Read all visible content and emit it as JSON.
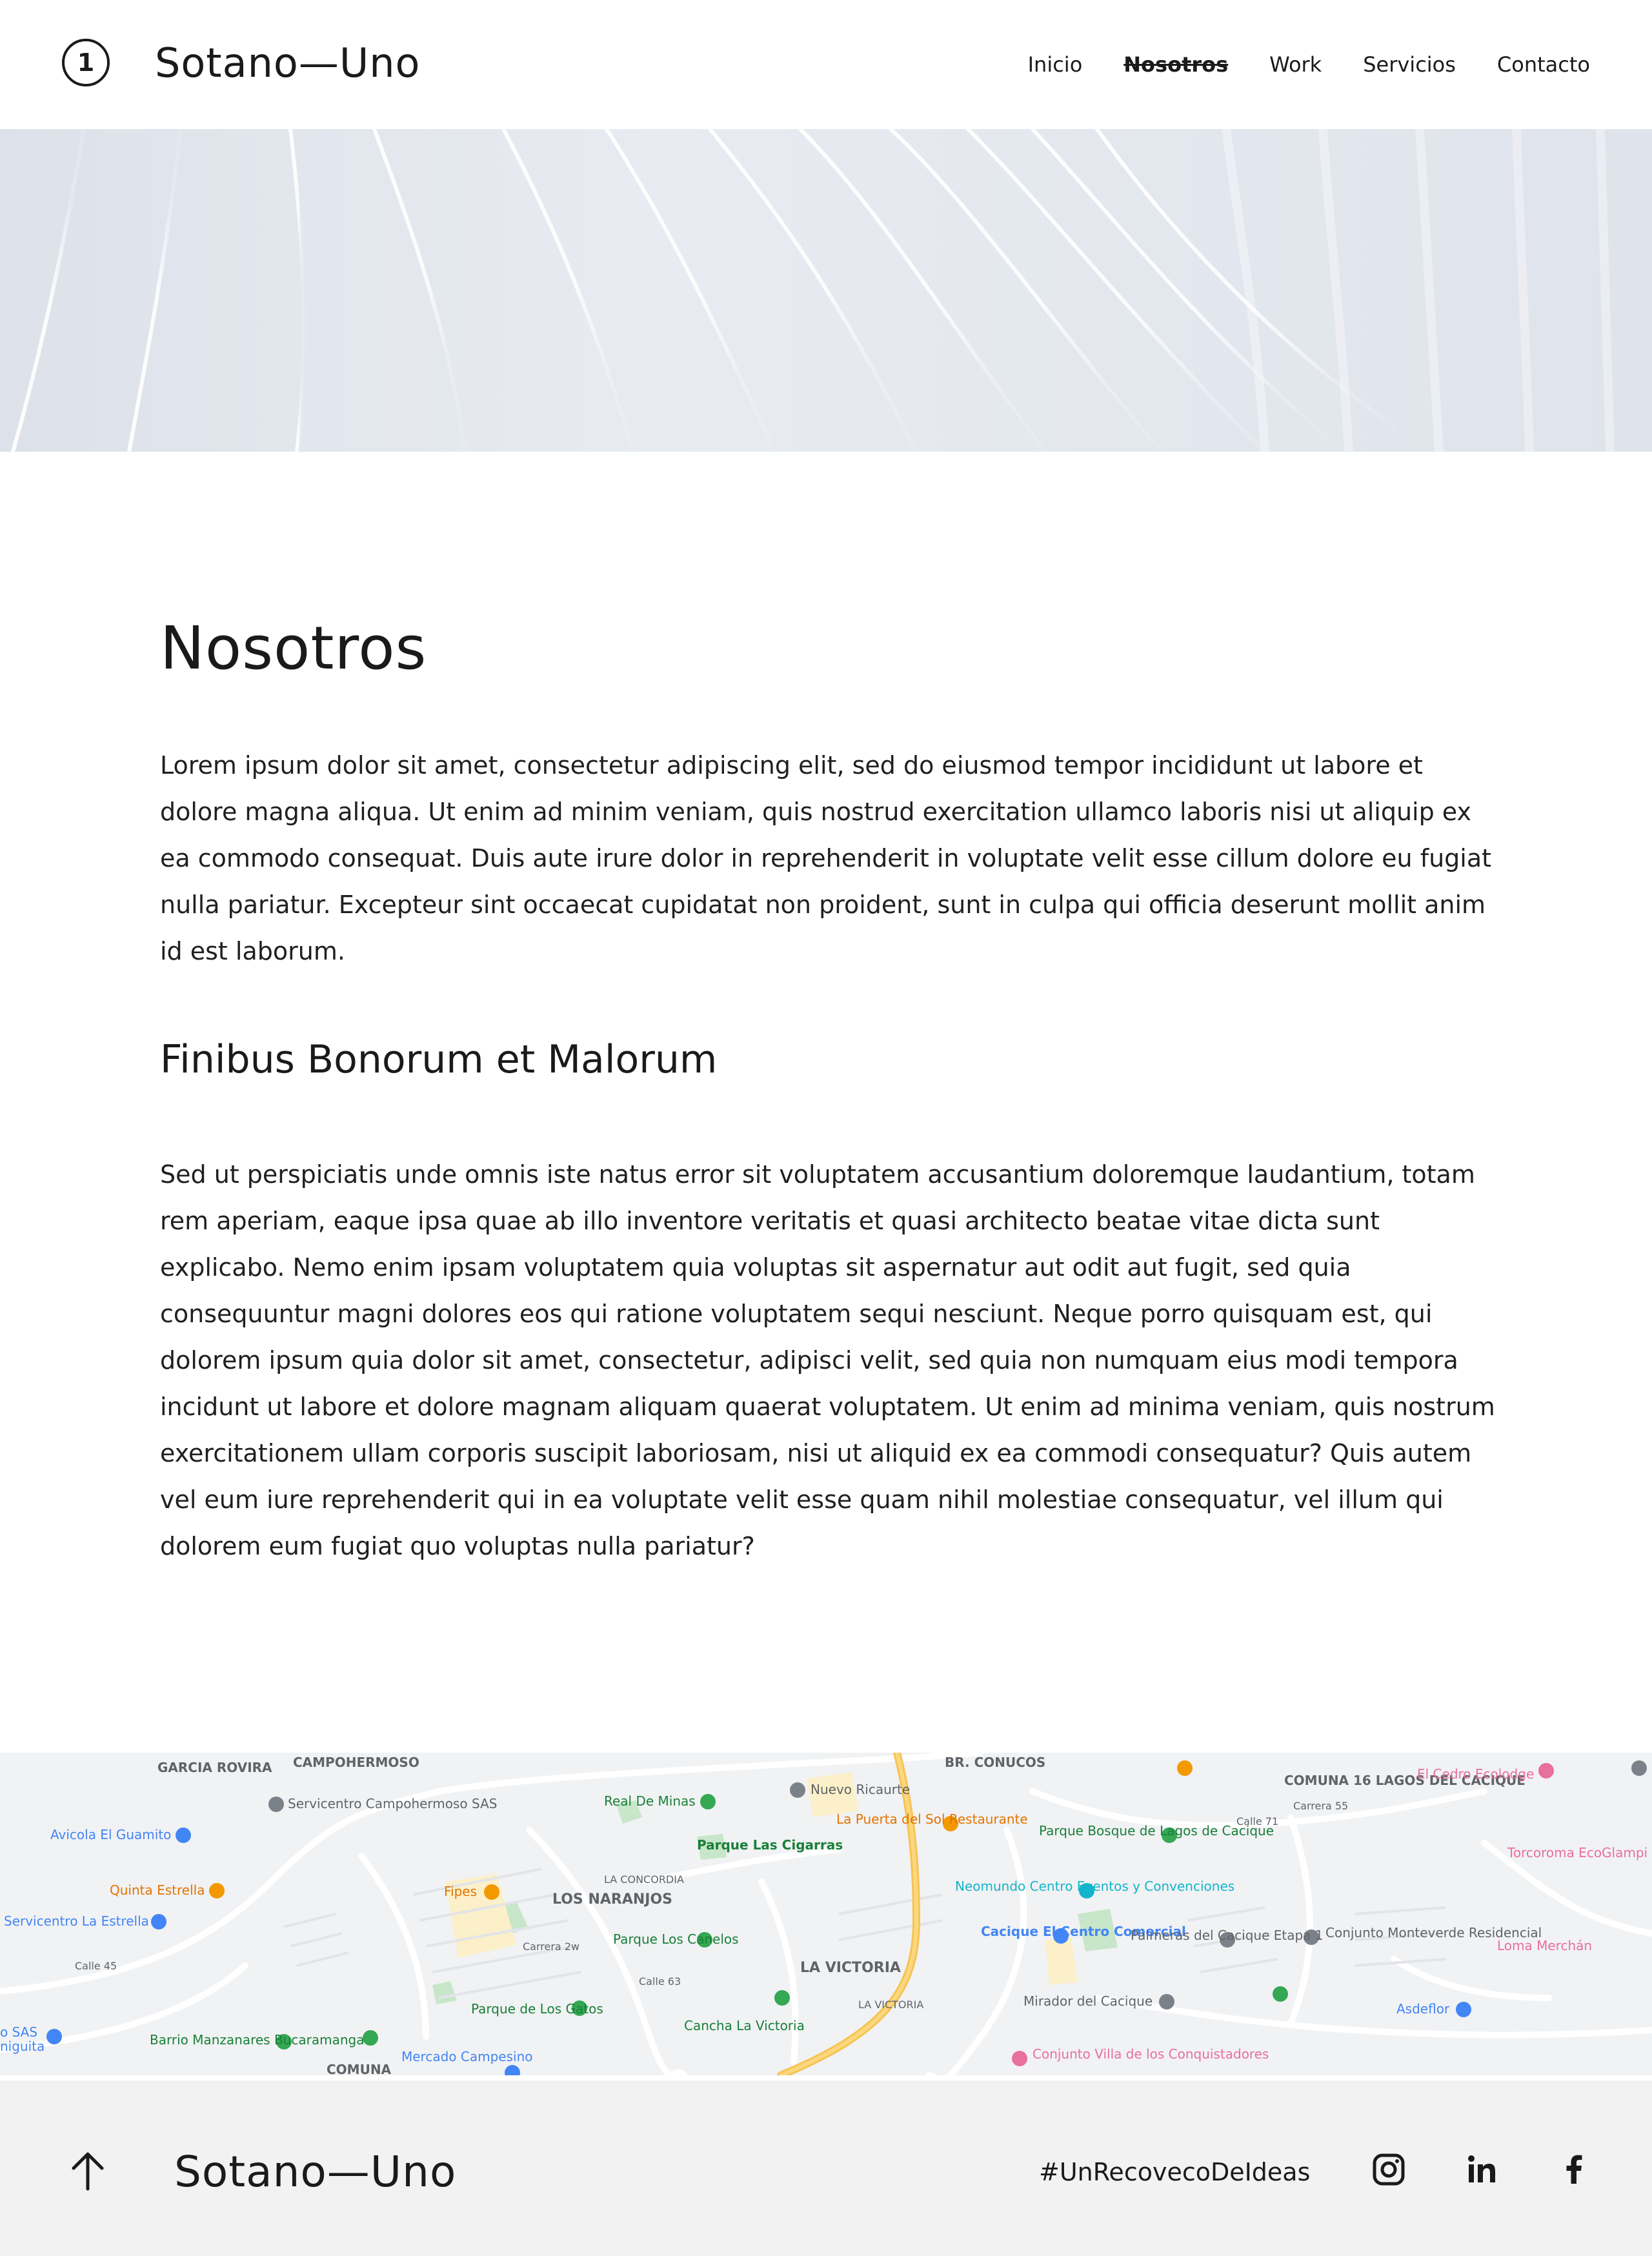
{
  "header": {
    "logo_number": "1",
    "brand": "Sotano—Uno",
    "nav": [
      "Inicio",
      "Nosotros",
      "Work",
      "Servicios",
      "Contacto"
    ],
    "active": "Nosotros"
  },
  "main": {
    "title": "Nosotros",
    "paragraph1": "Lorem ipsum dolor sit amet, consectetur adipiscing elit, sed do eiusmod tempor incididunt ut labore et dolore magna aliqua. Ut enim ad minim veniam, quis nostrud exercitation ullamco laboris nisi ut aliquip ex ea commodo consequat. Duis aute irure dolor in reprehenderit in voluptate velit esse cillum dolore eu fugiat nulla pariatur. Excepteur sint occaecat cupidatat non proident, sunt in culpa qui officia deserunt mollit anim id est laborum.",
    "subtitle": "Finibus Bonorum et Malorum",
    "paragraph2": "Sed ut perspiciatis unde omnis iste natus error sit voluptatem accusantium doloremque laudantium, totam rem aperiam, eaque ipsa quae ab illo inventore veritatis et quasi architecto beatae vitae dicta sunt explicabo. Nemo enim ipsam voluptatem quia voluptas sit aspernatur aut odit aut fugit, sed quia consequuntur magni dolores eos qui ratione voluptatem sequi nesciunt. Neque porro quisquam est, qui dolorem ipsum quia dolor sit amet, consectetur, adipisci velit, sed quia non numquam eius modi tempora incidunt ut labore et dolore magnam aliquam quaerat voluptatem. Ut enim ad minima veniam, quis nostrum exercitationem ullam corporis suscipit laboriosam, nisi ut aliquid ex ea commodi consequatur? Quis autem vel eum iure reprehenderit qui in ea voluptate velit esse quam nihil molestiae consequatur, vel illum qui dolorem eum fugiat quo voluptas nulla pariatur?"
  },
  "map": {
    "labels": {
      "garcia_rovira": "GARCIA ROVIRA",
      "campohermoso": "CAMPOHERMOSO",
      "br_conucos": "BR. CONUCOS",
      "comuna16": "COMUNA 16 LAGOS DEL CACIQUE",
      "real_de_minas": "Real De Minas",
      "nuevo_ricaurte": "Nuevo Ricaurte",
      "servicentro_campohermoso": "Servicentro Campohermoso SAS",
      "avicola": "Avicola El Guamito",
      "quinta_estrella": "Quinta Estrella",
      "servicentro_estrella": "Servicentro La Estrella",
      "parque_cigarras": "Parque Las Cigarras",
      "puerta_sol": "La Puerta del Sol Restaurante",
      "fipes": "Fipes",
      "la_concordia": "LA CONCORDIA",
      "los_naranjos": "LOS NARANJOS",
      "parque_bosque": "Parque Bosque de Lagos de Cacique",
      "neomundo": "Neomundo Centro Eventos y Convenciones",
      "cacique_cc": "Cacique El Centro Comercial",
      "palmeras": "Palmeras del Cacique Etapa 1",
      "monteverde": "Conjunto Monteverde Residencial",
      "cedro": "El Cedro Ecolodge",
      "torcoroma": "Torcoroma EcoGlampi",
      "loma_merchan": "Loma Merchán",
      "asdeflor": "Asdeflor",
      "parque_canelos": "Parque Los Canelos",
      "la_victoria": "LA VICTORIA",
      "la_victoria_small": "LA VICTORIA",
      "parque_gatos": "Parque de Los Gatos",
      "cancha": "Cancha La Victoria",
      "mirador": "Mirador del Cacique",
      "villa_conquistadores": "Conjunto Villa de los Conquistadores",
      "barrio_manzanares": "Barrio Manzanares Bucaramanga",
      "mercado": "Mercado Campesino",
      "comuna": "COMUNA",
      "sas_left": "o SAS",
      "niguita": "niguita",
      "calle45": "Calle 45",
      "carrera2w": "Carrera 2w",
      "calle63": "Calle 63",
      "calle71": "Calle 71",
      "carrera55": "Carrera 55"
    }
  },
  "footer": {
    "brand": "Sotano—Uno",
    "hashtag": "#UnRecovecoDeIdeas",
    "social": [
      "instagram",
      "linkedin",
      "facebook"
    ]
  }
}
